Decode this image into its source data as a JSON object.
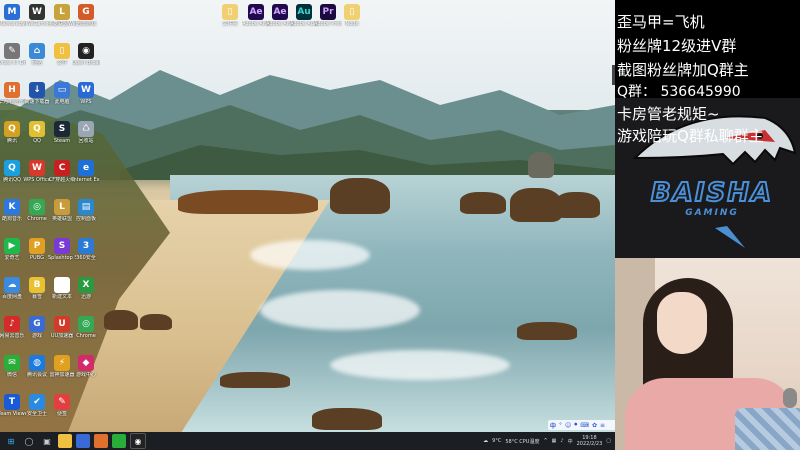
{
  "desktop_icons": [
    {
      "label": "Malwarebytes",
      "color": "#2b6fd6",
      "glyph": "M"
    },
    {
      "label": "WeGame",
      "color": "#333333",
      "glyph": "W"
    },
    {
      "label": "英雄联盟WeGame版",
      "color": "#c8a23a",
      "glyph": "L"
    },
    {
      "label": "迅雷游戏",
      "color": "#d45a2a",
      "glyph": "G"
    },
    {
      "label": "Draw it! Driver",
      "color": "#777777",
      "glyph": "✎"
    },
    {
      "label": "网络",
      "color": "#3a8ad6",
      "glyph": "⌂"
    },
    {
      "label": "文件",
      "color": "#f0c040",
      "glyph": "▯"
    },
    {
      "label": "Open Broadcaster",
      "color": "#222222",
      "glyph": "◉"
    },
    {
      "label": "华为电脑管家",
      "color": "#e07030",
      "glyph": "H"
    },
    {
      "label": "高速下载器",
      "color": "#2255aa",
      "glyph": "↓"
    },
    {
      "label": "此电脑",
      "color": "#3a7ad6",
      "glyph": "▭"
    },
    {
      "label": "WPS",
      "color": "#2a6ad6",
      "glyph": "W"
    },
    {
      "label": "腾讯",
      "color": "#d4a020",
      "glyph": "Q"
    },
    {
      "label": "QQ",
      "color": "#e0c030",
      "glyph": "Q"
    },
    {
      "label": "Steam",
      "color": "#1b2838",
      "glyph": "S"
    },
    {
      "label": "回收站",
      "color": "#9aa6b2",
      "glyph": "♺"
    },
    {
      "label": "腾讯QQ",
      "color": "#1aa0e0",
      "glyph": "Q"
    },
    {
      "label": "WPS Office",
      "color": "#d63a2a",
      "glyph": "W"
    },
    {
      "label": "CF穿越火线",
      "color": "#c82020",
      "glyph": "C"
    },
    {
      "label": "Internet Explorer",
      "color": "#1e6fd6",
      "glyph": "e"
    },
    {
      "label": "酷狗音乐",
      "color": "#2a78e0",
      "glyph": "K"
    },
    {
      "label": "Chrome",
      "color": "#34a853",
      "glyph": "◎"
    },
    {
      "label": "英雄联盟",
      "color": "#c89b3c",
      "glyph": "L"
    },
    {
      "label": "控制面板",
      "color": "#2a88d0",
      "glyph": "▤"
    },
    {
      "label": "爱奇艺",
      "color": "#1fb84a",
      "glyph": "▶"
    },
    {
      "label": "PUBG",
      "color": "#e0a020",
      "glyph": "P"
    },
    {
      "label": "Splashtop Streamer",
      "color": "#7a3ad6",
      "glyph": "S"
    },
    {
      "label": "360安全",
      "color": "#2a7ad6",
      "glyph": "3"
    },
    {
      "label": "百度网盘",
      "color": "#3a8ae0",
      "glyph": "☁"
    },
    {
      "label": "暴雪",
      "color": "#e8c030",
      "glyph": "B"
    },
    {
      "label": "新建文本",
      "color": "#ffffff",
      "glyph": ""
    },
    {
      "label": "迅游",
      "color": "#2a9a40",
      "glyph": "X"
    },
    {
      "label": "网易云音乐",
      "color": "#d42a2a",
      "glyph": "♪"
    },
    {
      "label": "游戏",
      "color": "#3a6ad6",
      "glyph": "G"
    },
    {
      "label": "UU加速器",
      "color": "#d43a2a",
      "glyph": "U"
    },
    {
      "label": "Chrome",
      "color": "#34a853",
      "glyph": "◎"
    },
    {
      "label": "微信",
      "color": "#2aae3a",
      "glyph": "✉"
    },
    {
      "label": "腾讯会议",
      "color": "#1a7ae0",
      "glyph": "◍"
    },
    {
      "label": "雷神加速器",
      "color": "#e0a020",
      "glyph": "⚡"
    },
    {
      "label": "游戏中心",
      "color": "#d42a6a",
      "glyph": "◆"
    },
    {
      "label": "Team Viewer",
      "color": "#1a5ad6",
      "glyph": "T"
    },
    {
      "label": "安全卫士",
      "color": "#2a8ae0",
      "glyph": "✔"
    },
    {
      "label": "便签",
      "color": "#e04040",
      "glyph": "✎"
    }
  ],
  "top_icons": [
    {
      "label": "文件夹",
      "color": "#f0d070",
      "glyph": "▯"
    },
    {
      "label": "Adobe After Effects",
      "color": "#1f0a4e",
      "glyph": "Ae",
      "fg": "#d8a8ff"
    },
    {
      "label": "Adobe After Effects",
      "color": "#1f0a4e",
      "glyph": "Ae",
      "fg": "#d8a8ff"
    },
    {
      "label": "Adobe Audition",
      "color": "#00303a",
      "glyph": "Au",
      "fg": "#3ad6d0"
    },
    {
      "label": "Adobe Premiere",
      "color": "#1a0a3e",
      "glyph": "Pr",
      "fg": "#c8a0ff"
    },
    {
      "label": "Node",
      "color": "#f0d070",
      "glyph": "▯"
    }
  ],
  "overlay": {
    "line1": "歪马甲=飞机",
    "line2": "粉丝牌12级进V群",
    "line3": "截图粉丝牌加Q群主",
    "line4": "Q群：  536645990",
    "line5": "卡房管老规矩~",
    "line6": "游戏陪玩Q群私聊群主"
  },
  "logo": {
    "main": "BAISHA",
    "sub": "GAMING"
  },
  "taskbar": {
    "weather": "9°C",
    "cpu": "58°C CPU温度",
    "time": "19:18",
    "date": "2022/2/23"
  },
  "ime": {
    "label": "中"
  }
}
